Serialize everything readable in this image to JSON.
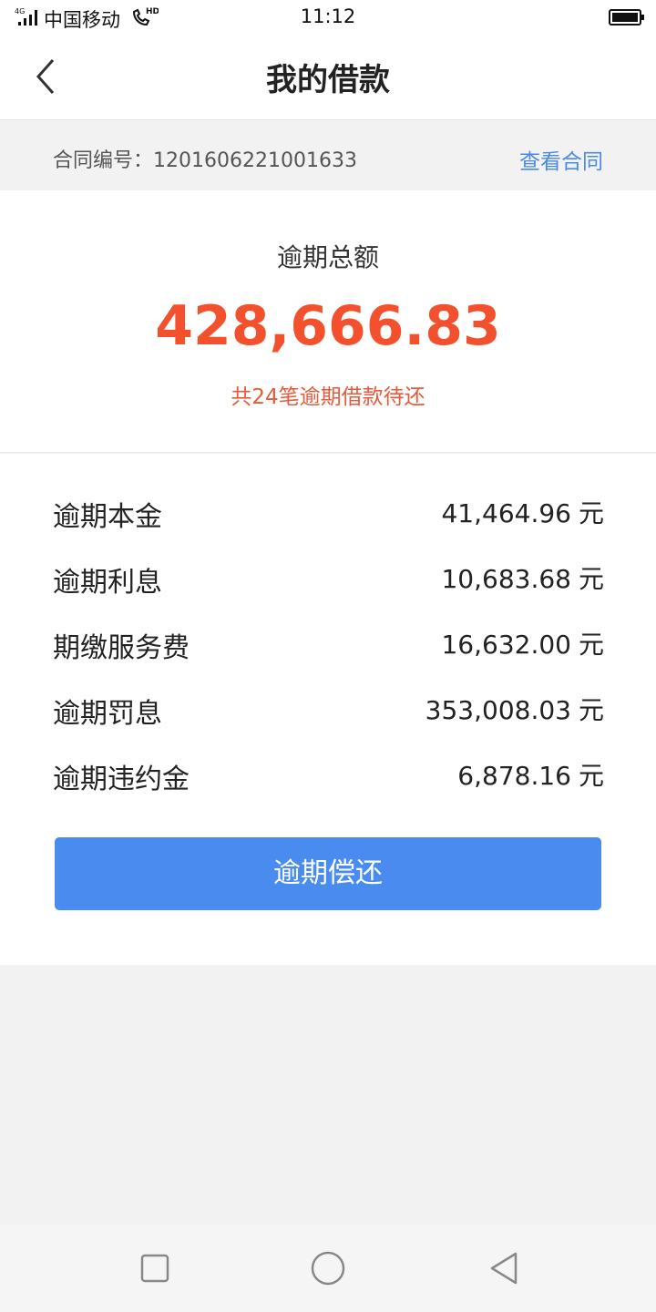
{
  "status_bar": {
    "network": "4G",
    "carrier": "中国移动",
    "call_badge": "HD",
    "time": "11:12"
  },
  "header": {
    "title": "我的借款",
    "back_icon": "chevron-left-icon"
  },
  "contract": {
    "label": "合同编号：1201606221001633",
    "view_link": "查看合同"
  },
  "summary": {
    "label": "逾期总额",
    "amount": "428,666.83",
    "note": "共24笔逾期借款待还"
  },
  "details": [
    {
      "label": "逾期本金",
      "value": "41,464.96",
      "unit": "元"
    },
    {
      "label": "逾期利息",
      "value": "10,683.68",
      "unit": "元"
    },
    {
      "label": "期缴服务费",
      "value": "16,632.00",
      "unit": "元"
    },
    {
      "label": "逾期罚息",
      "value": "353,008.03",
      "unit": "元"
    },
    {
      "label": "逾期违约金",
      "value": "6,878.16",
      "unit": "元"
    }
  ],
  "action": {
    "repay_label": "逾期偿还"
  },
  "colors": {
    "accent_blue": "#4a8bf0",
    "link_blue": "#4a8ae6",
    "amount_red": "#f3512e"
  },
  "system_nav": {
    "recent_icon": "square-icon",
    "home_icon": "circle-icon",
    "back_icon": "triangle-back-icon"
  }
}
